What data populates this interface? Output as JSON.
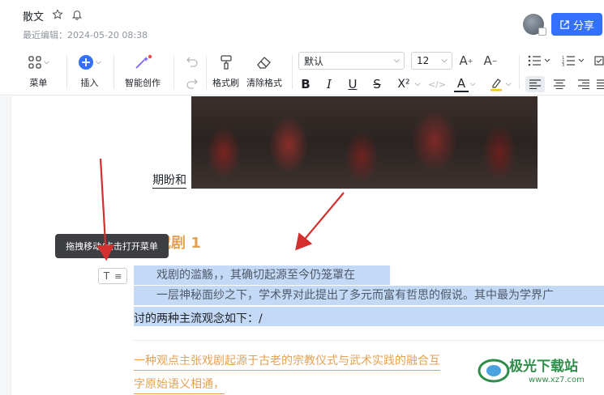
{
  "header": {
    "doc_title": "散文",
    "last_edit": "最近编辑：2024-05-20 08:38",
    "share_label": "分享"
  },
  "toolbar": {
    "menu_label": "菜单",
    "insert_label": "插入",
    "ai_label": "智能创作",
    "brush_label": "格式刷",
    "clear_label": "清除格式",
    "font_value": "默认",
    "size_value": "12",
    "font_grow": "A",
    "font_shrink": "A",
    "bold": "B",
    "italic": "I",
    "underline": "U",
    "strike": "S",
    "superscript": "X²",
    "code": "</>",
    "font_color": "A"
  },
  "editor": {
    "caption": "期盼和",
    "heading": "戏剧 1",
    "tooltip": "拖拽移动/点击打开菜单",
    "handle_T": "T",
    "para1": "戏剧的滥觞，，其确切起源至今仍笼罩在",
    "para2": "一层神秘面纱之下，学术界对此提出了多元而富有哲思的假说。其中最为学界广",
    "para3": "讨的两种主流观念如下：/",
    "para4": "一种观点主张戏剧起源于古老的宗教仪式与武术实践的融合互",
    "para5": "字原始语义相通，"
  },
  "watermark": {
    "brand": "极光下载站",
    "url": "www.xz7.com"
  },
  "colors": {
    "accent": "#3370ff",
    "heading": "#e5a153",
    "selection": "#c4d9f5",
    "arrow": "#d32f2f"
  }
}
